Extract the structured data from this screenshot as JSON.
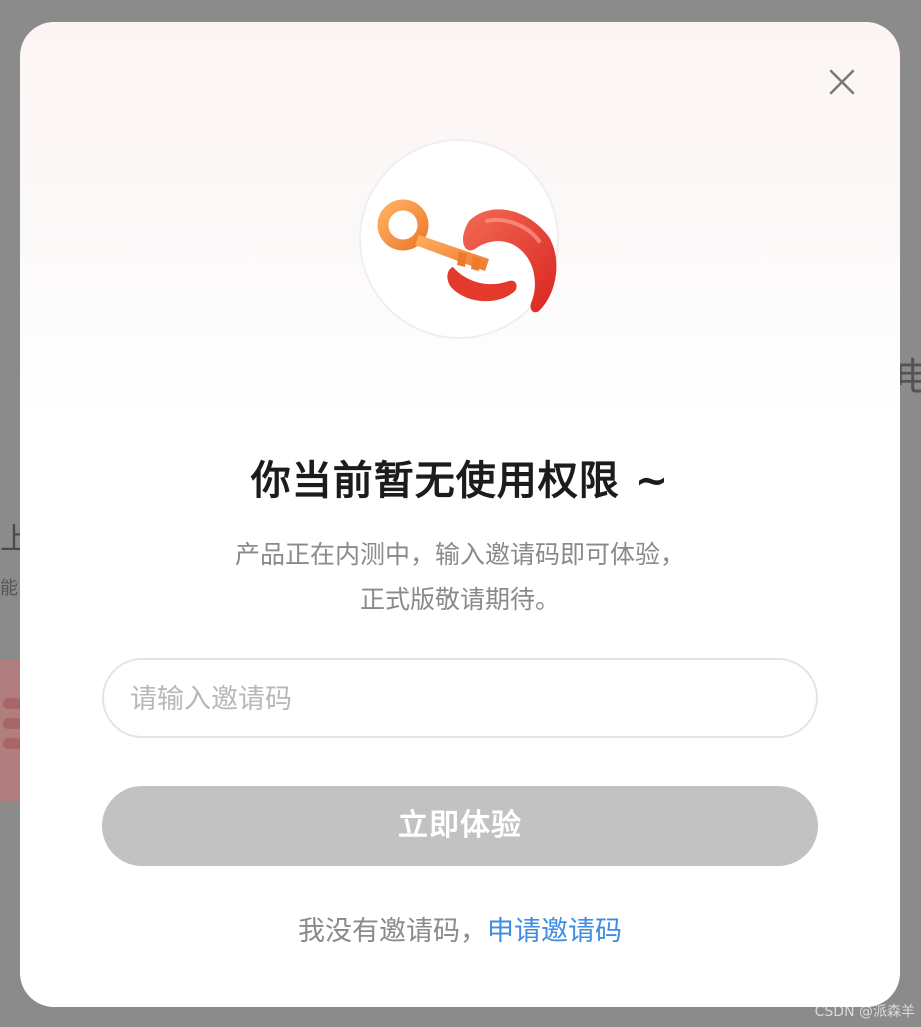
{
  "dialog": {
    "title": "你当前暂无使用权限 ~",
    "description_line1": "产品正在内测中，输入邀请码即可体验，",
    "description_line2": "正式版敬请期待。",
    "invite_input": {
      "value": "",
      "placeholder": "请输入邀请码"
    },
    "submit_label": "立即体验",
    "no_code_text": "我没有邀请码，",
    "apply_link_label": "申请邀请码",
    "icons": {
      "close": "close-icon",
      "logo": "key-in-claw-icon"
    }
  },
  "background": {
    "glyph_right": "电",
    "glyph_left_1": "上",
    "glyph_left_2": "能"
  },
  "watermark": "CSDN @派森羊",
  "colors": {
    "overlay": "#8b8b8b",
    "button_disabled": "#c2c2c2",
    "link": "#3d8ee3",
    "title": "#1c1c1c",
    "muted_text": "#8a8a8a",
    "key": "#f08a3c",
    "claw": "#e8332a"
  }
}
